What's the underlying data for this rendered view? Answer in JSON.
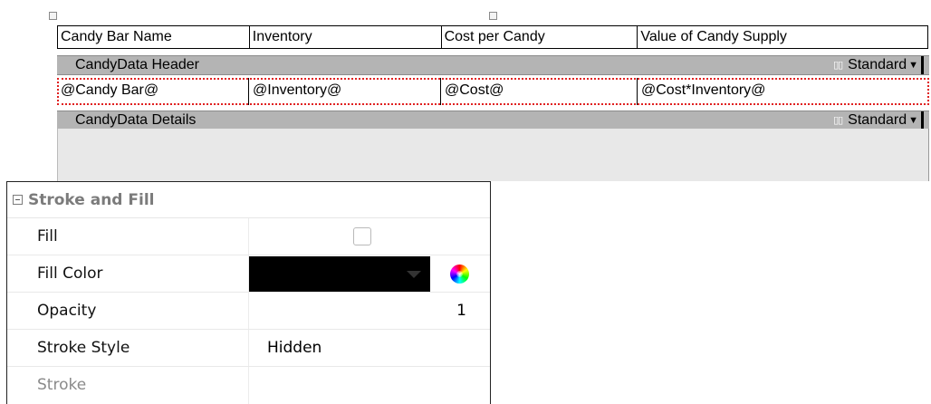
{
  "table": {
    "headers": [
      "Candy Bar Name",
      "Inventory",
      "Cost per Candy",
      "Value of Candy Supply"
    ],
    "header_band": {
      "name": "CandyData Header",
      "style": "Standard"
    },
    "detail_cells": [
      "@Candy Bar@",
      "@Inventory@",
      "@Cost@",
      "@Cost*Inventory@"
    ],
    "detail_band": {
      "name": "CandyData Details",
      "style": "Standard"
    }
  },
  "properties": {
    "category": "Stroke and Fill",
    "rows": [
      {
        "label": "Fill",
        "value": false
      },
      {
        "label": "Fill Color",
        "value": "#000000"
      },
      {
        "label": "Opacity",
        "value": "1"
      },
      {
        "label": "Stroke Style",
        "value": "Hidden"
      },
      {
        "label": "Stroke",
        "value": ""
      }
    ]
  },
  "icons": {
    "band_icon": "band-columns-icon",
    "band_caret": "chevron-down-icon",
    "collapse": "collapse-minus-icon",
    "color_picker": "color-wheel-icon",
    "dropdown_caret": "dropdown-caret-icon"
  },
  "colors": {
    "band_bg": "#b4b4b4",
    "selection_outline": "#e02020",
    "fill_color": "#000000"
  }
}
